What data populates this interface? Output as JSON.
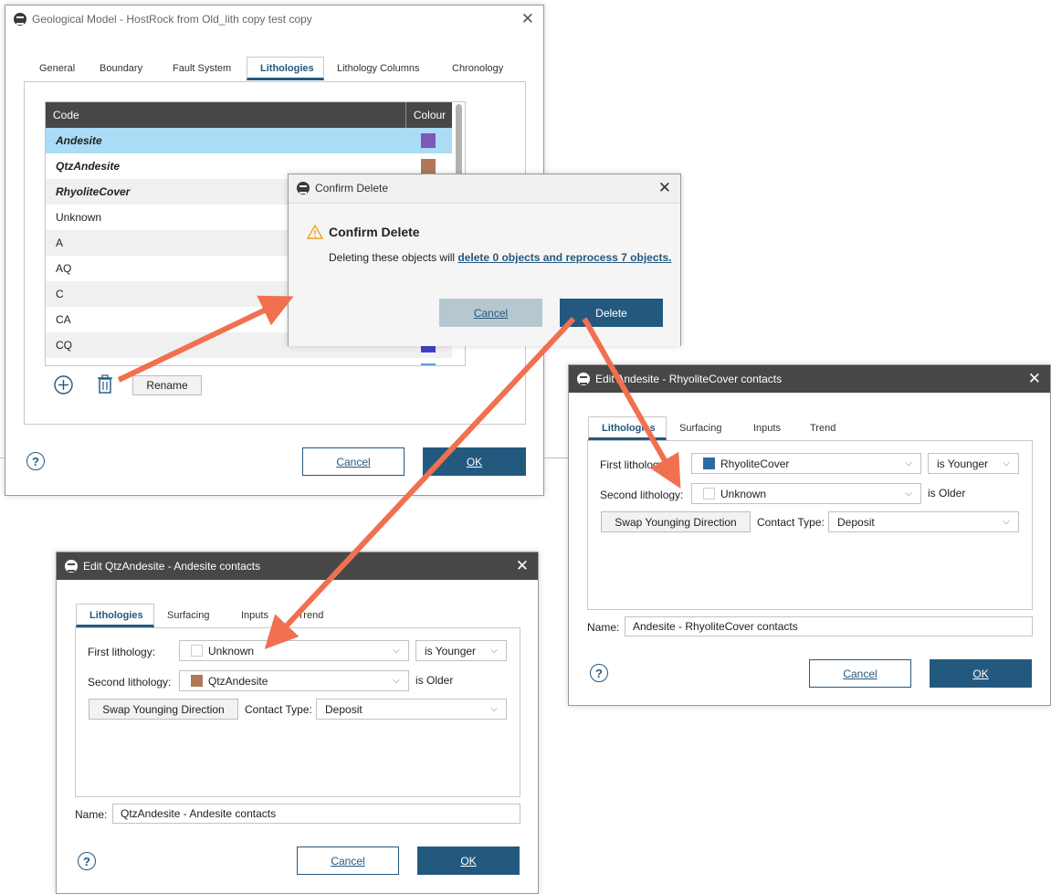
{
  "geo": {
    "title": "Geological Model - HostRock from Old_lith copy test copy",
    "tabs": [
      "General",
      "Boundary",
      "Fault System",
      "Lithologies",
      "Lithology Columns",
      "Chronology"
    ],
    "active_tab": "Lithologies",
    "table": {
      "headers": [
        "Code",
        "Colour"
      ],
      "rows": [
        {
          "name": "Andesite",
          "color": "#7e57b8",
          "bold": true,
          "selected": true
        },
        {
          "name": "QtzAndesite",
          "color": "#b0775a",
          "bold": true
        },
        {
          "name": "RhyoliteCover",
          "color": "#2e6aa0",
          "bold": true
        },
        {
          "name": "Unknown",
          "color": "#ffffff"
        },
        {
          "name": "A",
          "color": "#3aa0a0"
        },
        {
          "name": "AQ",
          "color": "#c14a4a"
        },
        {
          "name": "C",
          "color": "#6aa04a"
        },
        {
          "name": "CA",
          "color": "#d0a040"
        },
        {
          "name": "CQ",
          "color": "#4040c8"
        },
        {
          "name": "",
          "color": "#5aa0e0"
        }
      ]
    },
    "rename_label": "Rename",
    "help": "?",
    "cancel_label": "Cancel",
    "ok_label": "OK"
  },
  "confirm": {
    "title": "Confirm Delete",
    "heading": "Confirm Delete",
    "message_prefix": "Deleting these objects will",
    "message_link": "delete 0 objects and reprocess 7 objects.",
    "cancel_label": "Cancel",
    "delete_label": "Delete"
  },
  "edit_right": {
    "title": "Edit Andesite - RhyoliteCover contacts",
    "tabs": [
      "Lithologies",
      "Surfacing",
      "Inputs",
      "Trend"
    ],
    "first_label": "First lithology:",
    "first_value": "RhyoliteCover",
    "first_color": "#2e6aa0",
    "first_relation": "is Younger",
    "second_label": "Second lithology:",
    "second_value": "Unknown",
    "second_color": "#ffffff",
    "second_relation": "is Older",
    "swap_label": "Swap Younging Direction",
    "contact_label": "Contact Type:",
    "contact_value": "Deposit",
    "name_label": "Name:",
    "name_value": "Andesite - RhyoliteCover contacts",
    "cancel_label": "Cancel",
    "ok_label": "OK",
    "help": "?"
  },
  "edit_left": {
    "title": "Edit QtzAndesite - Andesite contacts",
    "tabs": [
      "Lithologies",
      "Surfacing",
      "Inputs",
      "Trend"
    ],
    "first_label": "First lithology:",
    "first_value": "Unknown",
    "first_color": "#ffffff",
    "first_relation": "is Younger",
    "second_label": "Second lithology:",
    "second_value": "QtzAndesite",
    "second_color": "#b0775a",
    "second_relation": "is Older",
    "swap_label": "Swap Younging Direction",
    "contact_label": "Contact Type:",
    "contact_value": "Deposit",
    "name_label": "Name:",
    "name_value": "QtzAndesite - Andesite contacts",
    "cancel_label": "Cancel",
    "ok_label": "OK",
    "help": "?"
  },
  "colors": {
    "accent": "#24597f",
    "selected_row": "#aadcf5",
    "title_dark": "#474747",
    "arrow": "#f07050"
  }
}
